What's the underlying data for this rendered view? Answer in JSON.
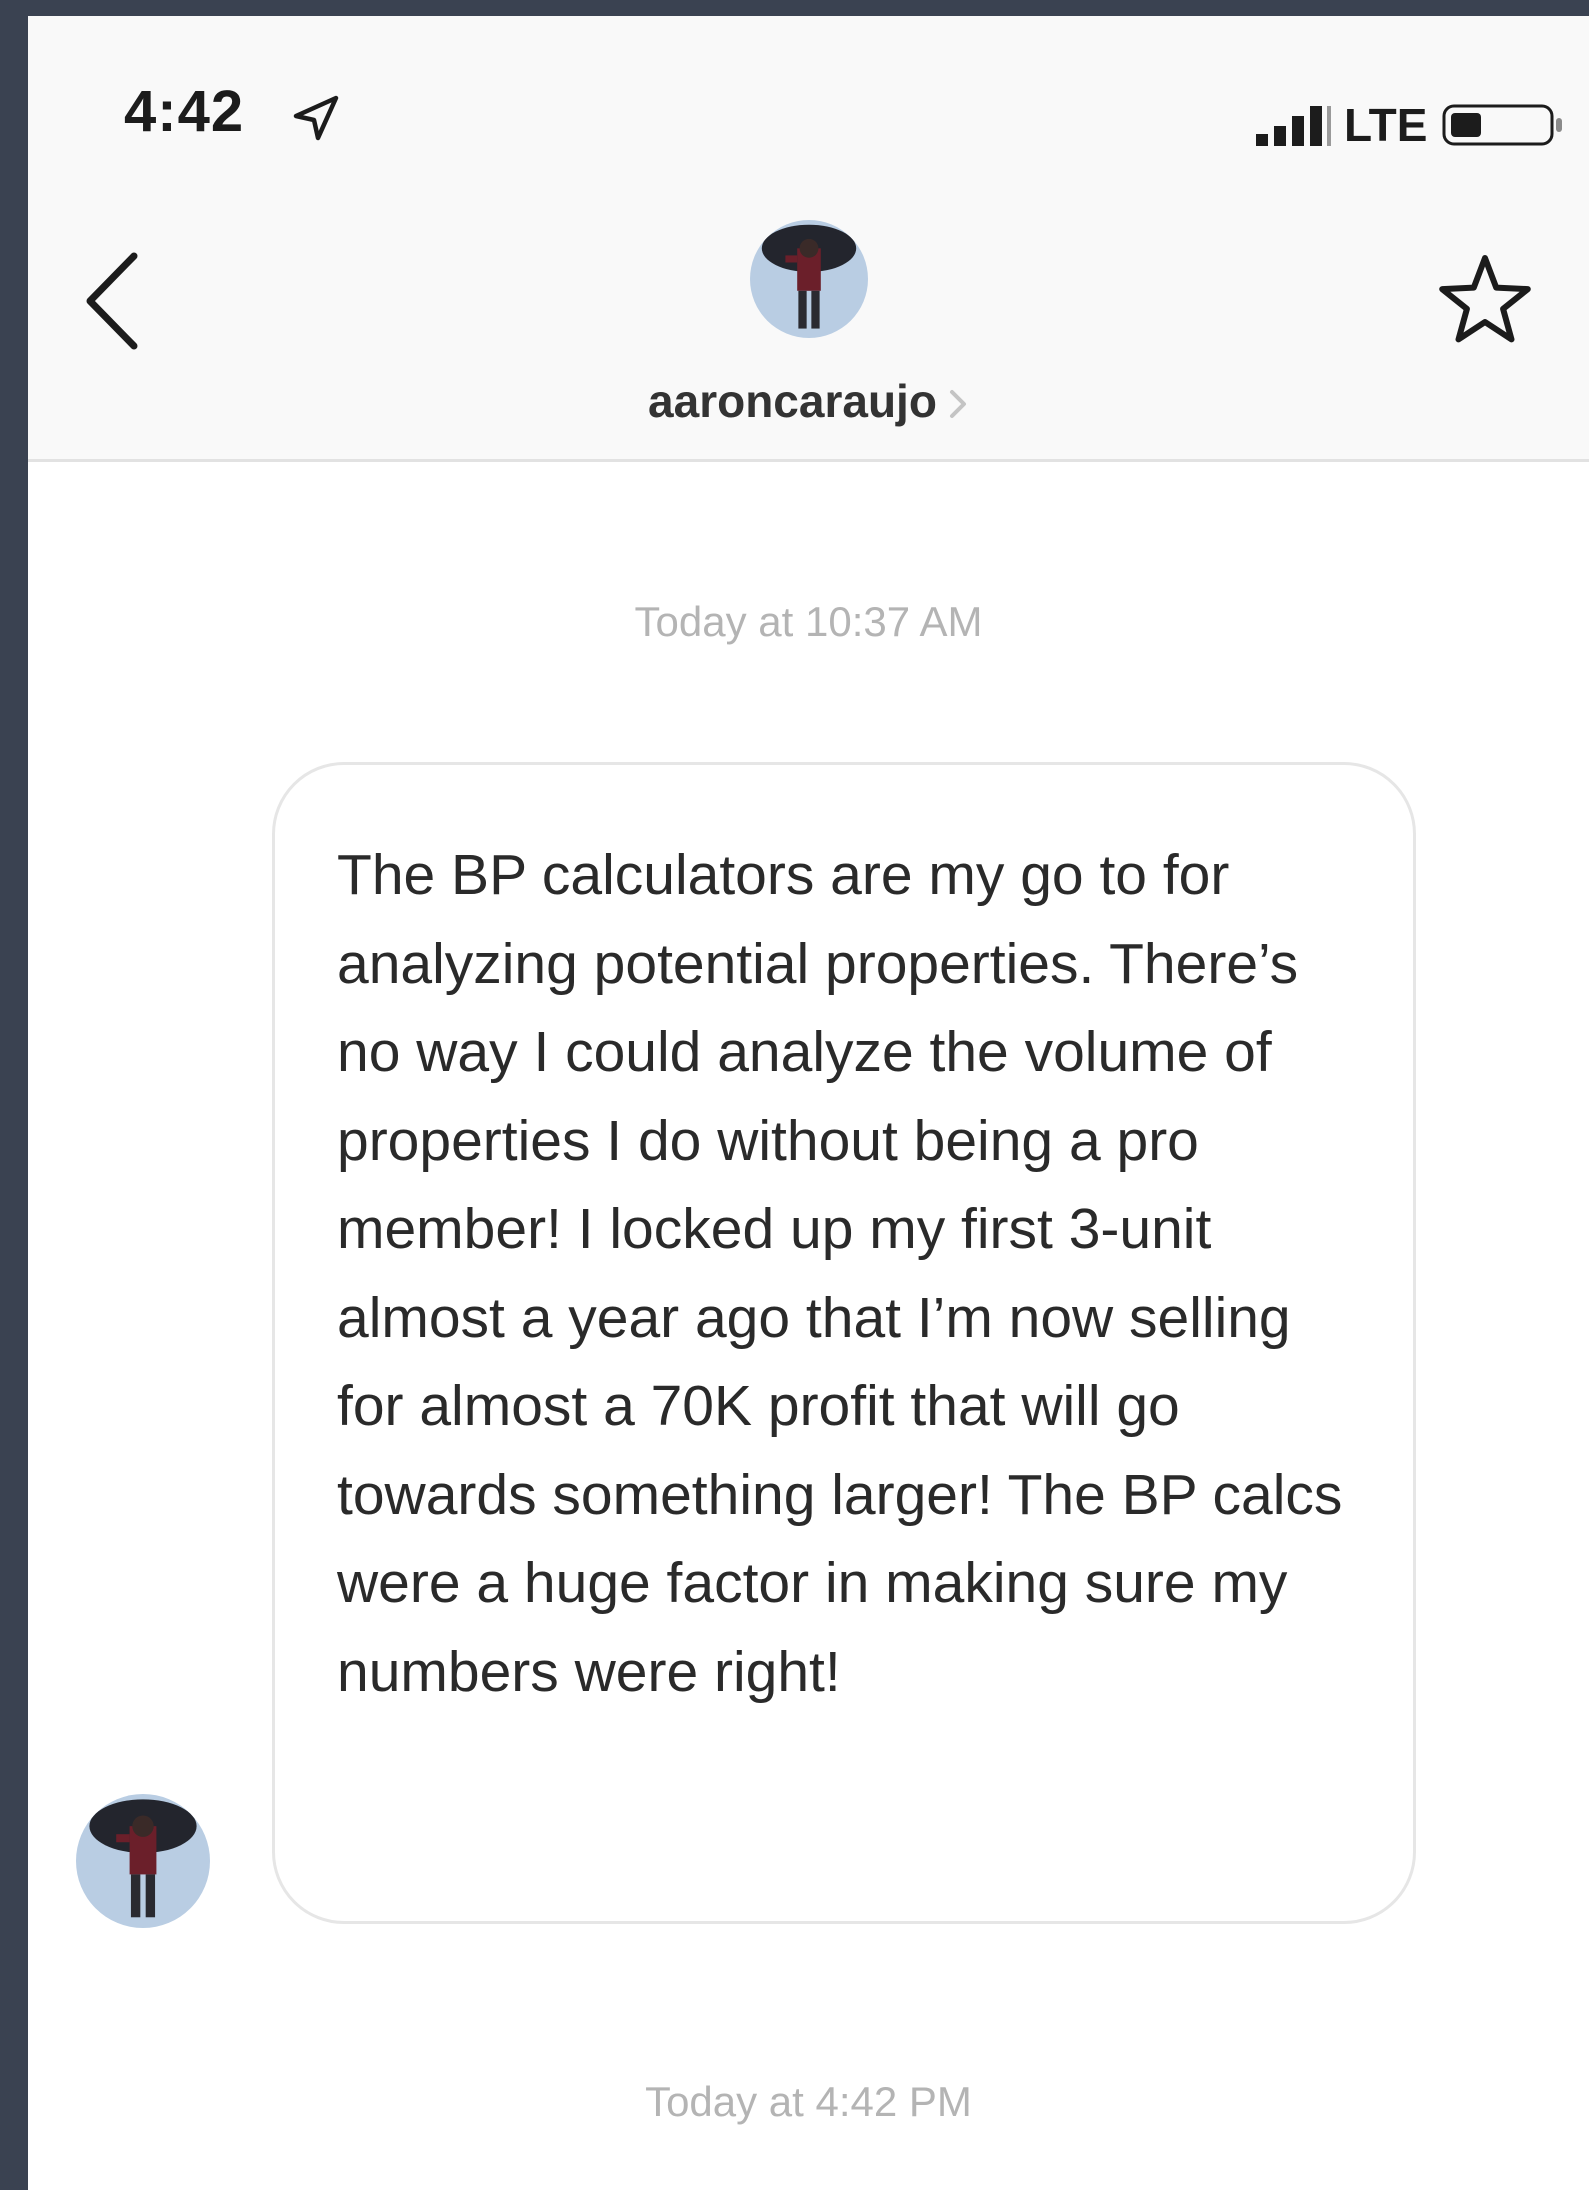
{
  "status_bar": {
    "time": "4:42",
    "network": "LTE",
    "icons": [
      "location-arrow-icon",
      "signal-bars-icon",
      "battery-icon"
    ]
  },
  "header": {
    "username": "aaroncaraujo",
    "icons": [
      "back-chevron-icon",
      "avatar",
      "chevron-right-icon",
      "star-icon"
    ]
  },
  "conversation": {
    "timestamps": [
      "Today at 10:37 AM",
      "Today at 4:42 PM"
    ],
    "messages": [
      {
        "sender": "aaroncaraujo",
        "text": "The BP calculators are my go to for analyzing potential properties. There’s no way I could analyze the volume of properties I do without being a pro member! I locked up my first 3-unit almost a year ago that I’m now selling for almost a 70K profit that will go towards something larger! The BP calcs were a huge factor in making sure my numbers were right!"
      }
    ]
  },
  "colors": {
    "page_background": "#3a4251",
    "header_background": "#f9f9f9",
    "bubble_border": "#e6e6e6",
    "timestamp_text": "#b4b4b4",
    "message_text": "#2a2a2a"
  }
}
